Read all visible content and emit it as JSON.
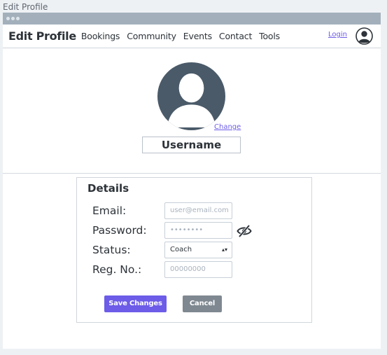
{
  "page": {
    "caption": "Edit Profile"
  },
  "navbar": {
    "brand": "Edit Profile",
    "links": [
      "Bookings",
      "Community",
      "Events",
      "Contact",
      "Tools"
    ],
    "login": "Login"
  },
  "profile": {
    "change_label": "Change",
    "username": "Username"
  },
  "details": {
    "title": "Details",
    "fields": {
      "email": {
        "label": "Email:",
        "placeholder": "user@email.com"
      },
      "password": {
        "label": "Password:",
        "value": "••••••••"
      },
      "status": {
        "label": "Status:",
        "value": "Coach"
      },
      "reg_no": {
        "label": "Reg. No.:",
        "placeholder": "00000000"
      }
    },
    "buttons": {
      "save": "Save Changes",
      "cancel": "Cancel"
    }
  },
  "colors": {
    "accent": "#6c5ce7",
    "titlebar": "#a3b0bc",
    "cancel": "#7f8891",
    "avatar": "#4a5a69"
  },
  "icons": {
    "avatar": "user-avatar-icon",
    "password_visibility": "eye-slash-icon",
    "select": "select-arrows-icon"
  }
}
